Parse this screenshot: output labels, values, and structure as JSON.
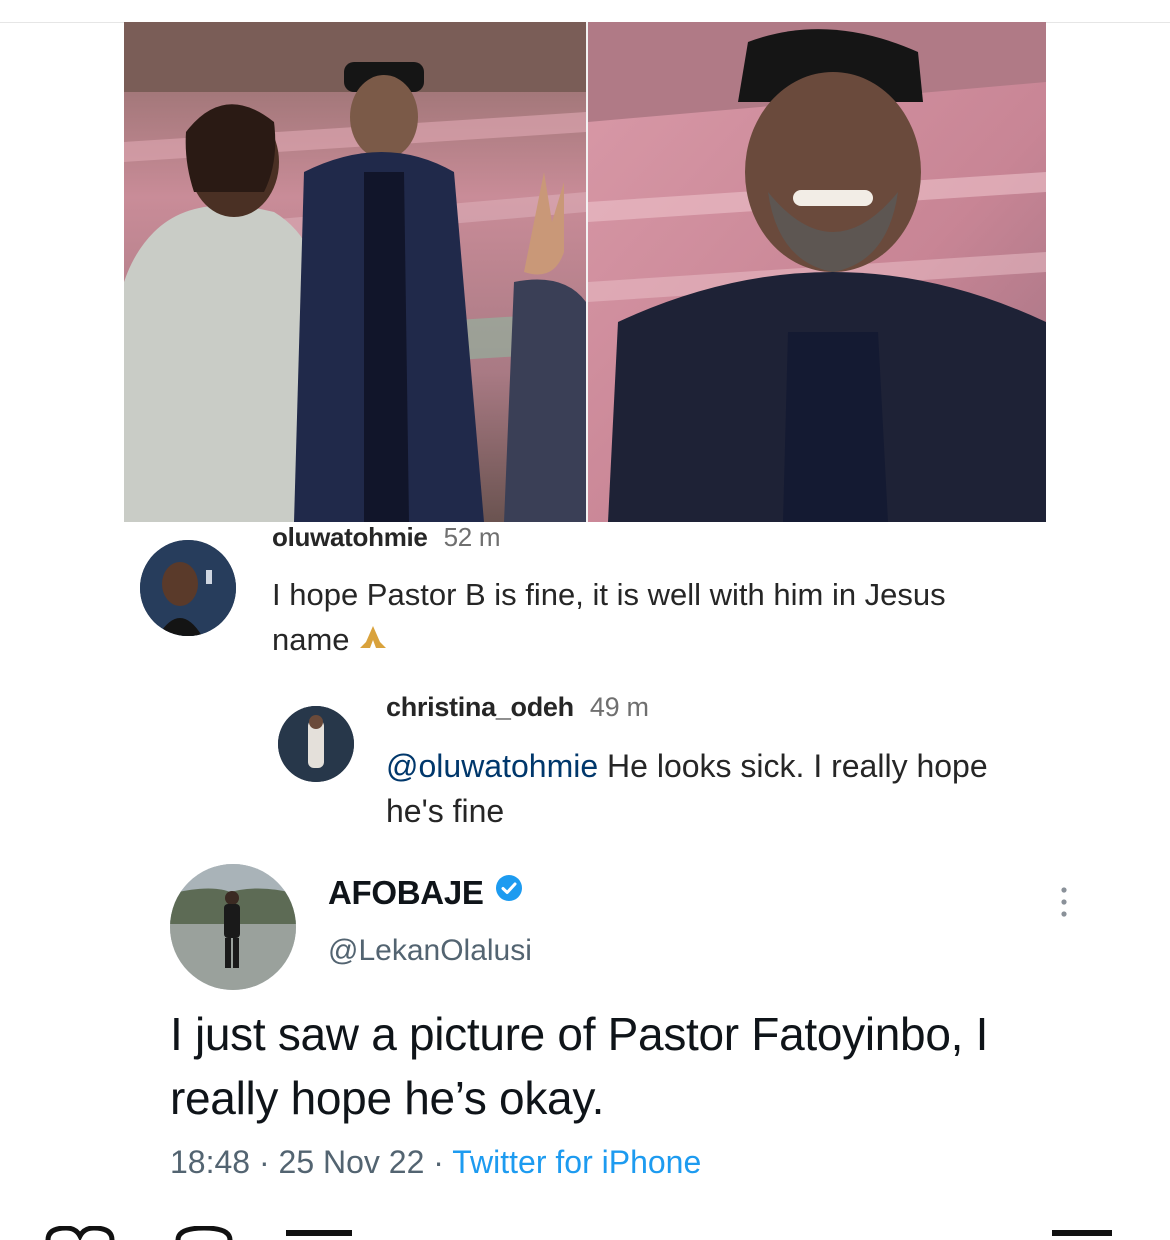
{
  "comments": [
    {
      "username": "oluwatohmie",
      "time": "52 m",
      "text": "I hope Pastor B is fine, it is well with him in Jesus name",
      "emoji_icon": "folded-hands-icon"
    },
    {
      "username": "christina_odeh",
      "time": "49 m",
      "mention": "@oluwatohmie",
      "text": " He looks sick. I really hope he's fine"
    }
  ],
  "tweet": {
    "name": "AFOBAJE",
    "handle": "@LekanOlalusi",
    "text": "I just saw a picture of Pastor Fatoyinbo, I really hope he’s okay.",
    "time": "18:48",
    "date": "25 Nov 22",
    "source": "Twitter for iPhone",
    "verified_color": "#1d9bf0"
  },
  "icons": [
    "verified-badge-icon",
    "more-icon",
    "folded-hands-icon"
  ]
}
